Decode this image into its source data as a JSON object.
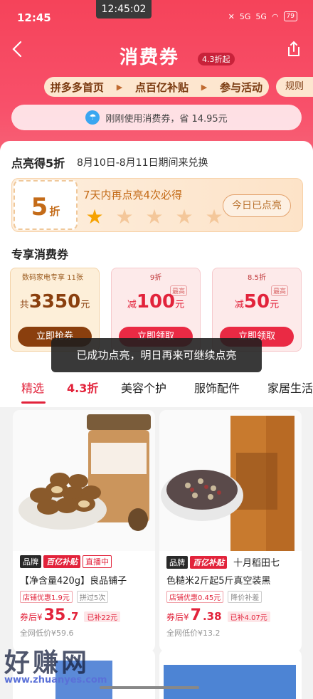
{
  "status_bar": {
    "time": "12:45",
    "center_time": "12:45:02",
    "signal_left": "5G",
    "signal_right": "5G",
    "battery": "79"
  },
  "header": {
    "title": "消费券",
    "badge": "4.3折起",
    "nav": [
      "拼多多首页",
      "点百亿补贴",
      "参与活动"
    ],
    "rules": "规则",
    "notice": "刚刚使用消费券，省 14.95元"
  },
  "light": {
    "heading": "点亮得5折",
    "date": "8月10日-8月11日期间来兑换",
    "discount_num": "5",
    "discount_unit": "折",
    "hint": "7天内再点亮4次必得",
    "stars_lit": 1,
    "stars_total": 5,
    "today_button": "今日已点亮"
  },
  "vouchers": {
    "heading": "专享消费券",
    "items": [
      {
        "tag": "数码家电专享 11张",
        "prefix": "共",
        "amount": "3350",
        "unit": "元",
        "max": "",
        "button": "立即抢券"
      },
      {
        "tag": "9折",
        "prefix": "减",
        "amount": "100",
        "unit": "元",
        "max": "最高",
        "button": "立即领取"
      },
      {
        "tag": "8.5折",
        "prefix": "减",
        "amount": "50",
        "unit": "元",
        "max": "最高",
        "button": "立即领取"
      }
    ]
  },
  "toast": "已成功点亮，明日再来可继续点亮",
  "tabs": [
    "精选",
    "4.3折",
    "美容个护",
    "服饰配件",
    "家居生活"
  ],
  "products": [
    {
      "badge_brand": "品牌",
      "badge_subsidy": "百亿补贴",
      "badge_live": "直播中",
      "title_line1": "【净含量420g】良品铺子",
      "title_line2": "",
      "tag1": "店铺优惠1.9元",
      "tag2": "拼过5次",
      "price_prefix": "券后¥",
      "price": "35",
      "price_dec": ".7",
      "subsidy": "已补22元",
      "old_price": "全网低价¥59.6"
    },
    {
      "badge_brand": "品牌",
      "badge_subsidy": "百亿补贴",
      "badge_live": "",
      "title_line1": "十月稻田七",
      "title_line2": "色糙米2斤起5斤真空装黑",
      "tag1": "店铺优惠0.45元",
      "tag2": "降价补差",
      "price_prefix": "券后¥",
      "price": "7",
      "price_dec": ".38",
      "subsidy": "已补4.07元",
      "old_price": "全网低价¥13.2"
    }
  ],
  "watermark": {
    "text": "好赚网",
    "url": "www.zhuanyes.com"
  },
  "colors": {
    "primary": "#f5435a",
    "accent_red": "#e2233b",
    "gold_text": "#c46b18"
  },
  "icons": {
    "back": "chevron-left-icon",
    "share": "share-icon",
    "star": "star-icon"
  }
}
